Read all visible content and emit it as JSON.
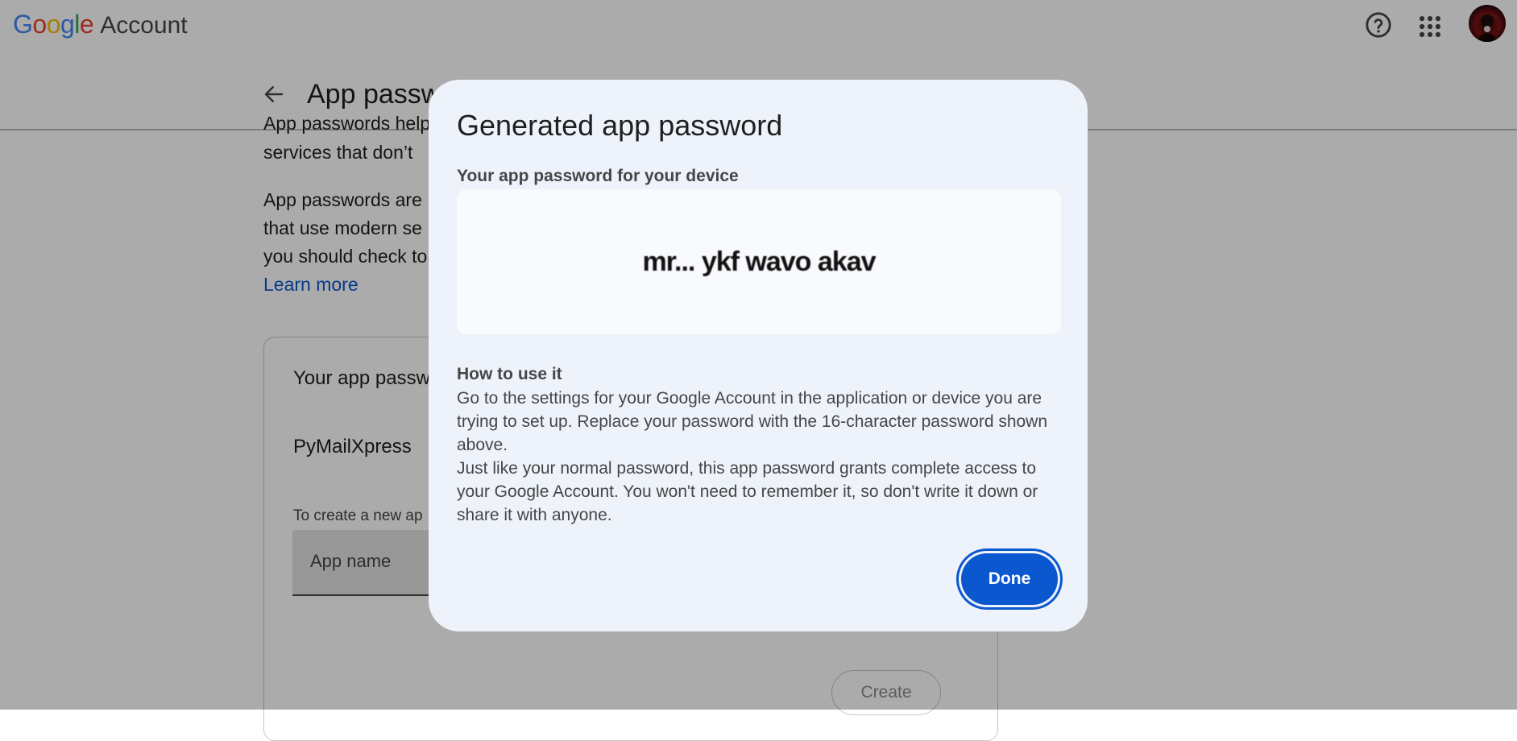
{
  "header": {
    "logo_text": "Google",
    "product": "Account"
  },
  "page": {
    "title": "App passw",
    "intro_line1": "App passwords help",
    "intro_line2": "services that don’t",
    "para2_line1": "App passwords are",
    "para2_line2": "that use modern se",
    "para2_line3": "you should check to",
    "learn_more": "Learn more",
    "card_title": "Your app passw",
    "app_entry": "PyMailXpress",
    "create_hint": "To create a new ap",
    "app_name_placeholder": "App name",
    "create_label": "Create"
  },
  "dialog": {
    "title": "Generated app password",
    "subtitle": "Your app password for your device",
    "password": "mr... ykf wavo akav",
    "how_title": "How to use it",
    "how_p1": "Go to the settings for your Google Account in the application or device you are trying to set up. Replace your password with the 16-character password shown above.",
    "how_p2": "Just like your normal password, this app password grants complete access to your Google Account. You won't need to remember it, so don't write it down or share it with anyone.",
    "done_label": "Done"
  },
  "colors": {
    "google_blue": "#4285F4",
    "google_red": "#EA4335",
    "google_yellow": "#FBBC05",
    "google_green": "#34A853",
    "link": "#0b57d0",
    "primary_button": "#0b57d0",
    "dialog_bg": "#eef3fb"
  },
  "icons": {
    "help": "help-circle-icon",
    "apps": "apps-grid-icon",
    "back": "arrow-back-icon"
  }
}
